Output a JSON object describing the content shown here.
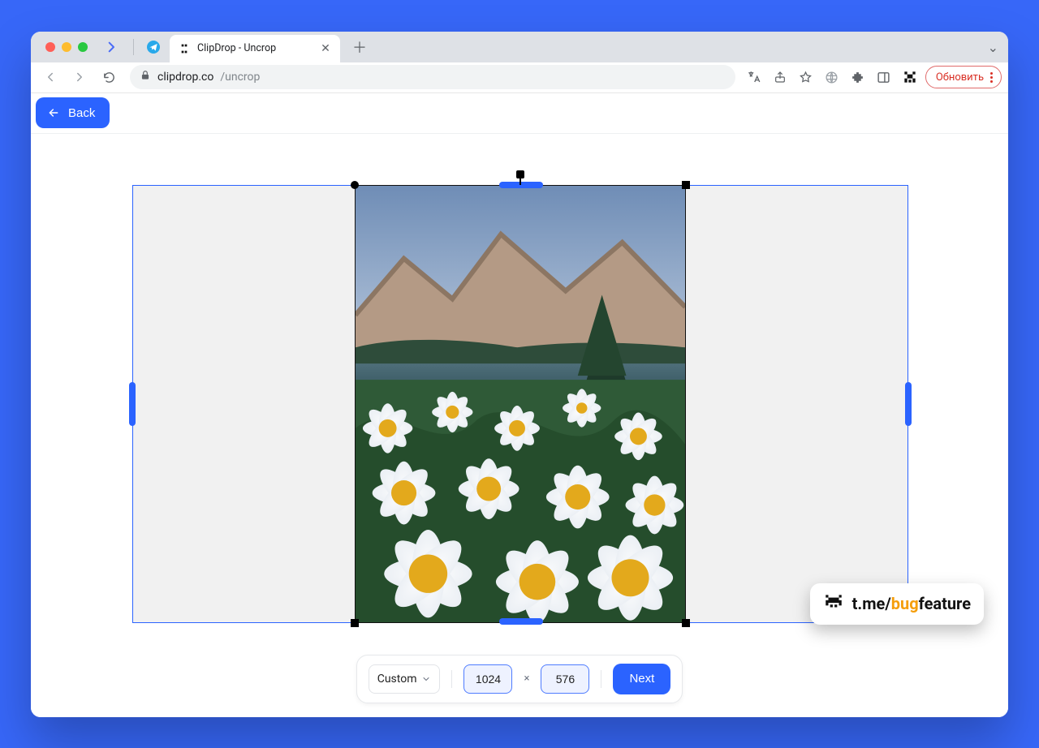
{
  "browser": {
    "tab_title": "ClipDrop - Uncrop",
    "url_host": "clipdrop.co",
    "url_path": "/uncrop",
    "update_label": "Обновить"
  },
  "topbar": {
    "back_label": "Back"
  },
  "controls": {
    "preset_label": "Custom",
    "width": "1024",
    "height": "576",
    "times": "×",
    "next_label": "Next"
  },
  "badge": {
    "prefix": "t.me/",
    "mid": "bug",
    "suffix": "feature"
  }
}
